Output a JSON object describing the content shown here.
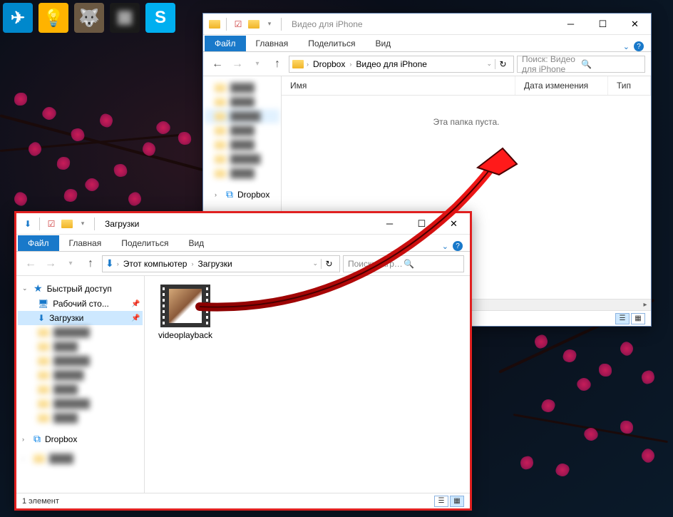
{
  "taskbar_icons": [
    "telegram-icon",
    "tips-icon",
    "gimp-icon",
    "unknown-icon",
    "skype-icon"
  ],
  "win1": {
    "title": "Видео для iPhone",
    "tabs": {
      "file": "Файл",
      "home": "Главная",
      "share": "Поделиться",
      "view": "Вид"
    },
    "breadcrumbs": [
      "Dropbox",
      "Видео для iPhone"
    ],
    "search_placeholder": "Поиск: Видео для iPhone",
    "cols": {
      "name": "Имя",
      "date": "Дата изменения",
      "type": "Тип"
    },
    "empty": "Эта папка пуста.",
    "navtree": {
      "dropbox": "Dropbox",
      "blurred_items_count": 7
    }
  },
  "win2": {
    "title": "Загрузки",
    "tabs": {
      "file": "Файл",
      "home": "Главная",
      "share": "Поделиться",
      "view": "Вид"
    },
    "breadcrumbs": [
      "Этот компьютер",
      "Загрузки"
    ],
    "search_placeholder": "Поиск: Загрузки",
    "navtree": {
      "quick": "Быстрый доступ",
      "desktop": "Рабочий сто...",
      "downloads": "Загрузки",
      "dropbox": "Dropbox",
      "blurred_items_count": 7
    },
    "file": {
      "name": "videoplayback"
    },
    "status": "1 элемент"
  },
  "arrow": {
    "color": "#e02020",
    "stroke": "#5a0000"
  }
}
